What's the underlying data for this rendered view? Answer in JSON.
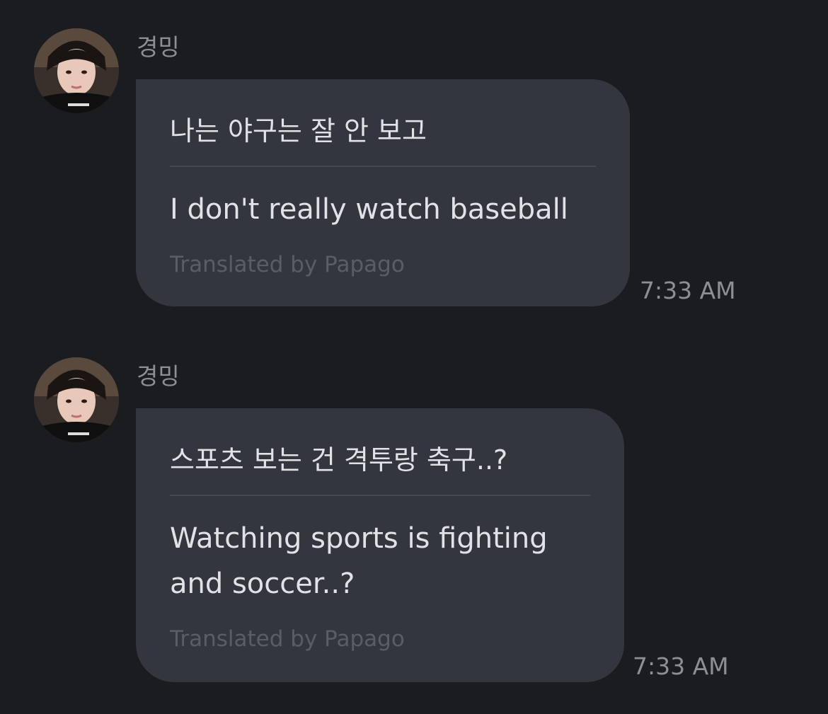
{
  "messages": [
    {
      "sender": "경밍",
      "avatar_icon": "profile-photo",
      "original": "나는 야구는 잘 안 보고",
      "translation": "I don't really watch baseball",
      "credit": "Translated by Papago",
      "time": "7:33 AM"
    },
    {
      "sender": "경밍",
      "avatar_icon": "profile-photo",
      "original": "스포츠 보는 건 격투랑 축구..?",
      "translation": "Watching sports is fighting and soccer..?",
      "credit": "Translated by Papago",
      "time": "7:33 AM"
    }
  ],
  "colors": {
    "background": "#1b1c20",
    "bubble": "#33363e",
    "text": "#e1e2e6",
    "muted": "#8d8f95"
  }
}
